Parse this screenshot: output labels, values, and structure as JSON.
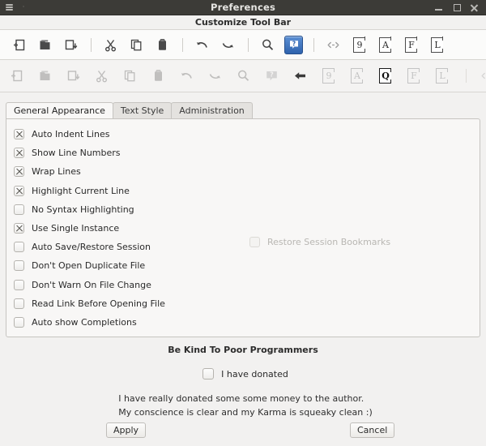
{
  "window": {
    "title": "Preferences",
    "menu_icon": "hamburger-icon",
    "controls": {
      "minimize": "minimize-icon",
      "maximize": "maximize-icon",
      "close": "close-icon"
    }
  },
  "subheader": {
    "title": "Customize Tool Bar"
  },
  "toolbar_active": {
    "items": [
      {
        "name": "new-file-icon",
        "type": "icon",
        "label": "New File"
      },
      {
        "name": "open-folder-icon",
        "type": "icon",
        "label": "Open File"
      },
      {
        "name": "save-file-icon",
        "type": "icon",
        "label": "Save File"
      },
      {
        "name": "separator",
        "type": "sep",
        "label": ""
      },
      {
        "name": "cut-icon",
        "type": "icon",
        "label": "Cut"
      },
      {
        "name": "copy-icon",
        "type": "icon",
        "label": "Copy"
      },
      {
        "name": "paste-icon",
        "type": "icon",
        "label": "Paste"
      },
      {
        "name": "separator",
        "type": "sep",
        "label": ""
      },
      {
        "name": "undo-icon",
        "type": "icon",
        "label": "Undo"
      },
      {
        "name": "redo-icon",
        "type": "icon",
        "label": "Redo"
      },
      {
        "name": "separator",
        "type": "sep",
        "label": ""
      },
      {
        "name": "search-icon",
        "type": "icon",
        "label": "Find"
      },
      {
        "name": "help-icon",
        "type": "icon",
        "label": "Help"
      },
      {
        "name": "separator",
        "type": "sep",
        "label": ""
      },
      {
        "name": "code-tags-icon",
        "type": "icon",
        "label": "Code"
      },
      {
        "name": "line-number-box-icon",
        "type": "letterbox",
        "label": "9"
      },
      {
        "name": "letter-a-box-icon",
        "type": "letterbox",
        "label": "A"
      },
      {
        "name": "letter-f-box-icon",
        "type": "letterbox",
        "label": "F"
      },
      {
        "name": "letter-l-box-icon",
        "type": "letterbox",
        "label": "L"
      }
    ]
  },
  "toolbar_available": {
    "items": [
      {
        "name": "new-file-icon",
        "type": "icon",
        "label": "New File",
        "state": "disabled"
      },
      {
        "name": "open-folder-icon",
        "type": "icon",
        "label": "Open File",
        "state": "disabled"
      },
      {
        "name": "save-file-icon",
        "type": "icon",
        "label": "Save File",
        "state": "disabled"
      },
      {
        "name": "cut-icon",
        "type": "icon",
        "label": "Cut",
        "state": "disabled"
      },
      {
        "name": "copy-icon",
        "type": "icon",
        "label": "Copy",
        "state": "disabled"
      },
      {
        "name": "paste-icon",
        "type": "icon",
        "label": "Paste",
        "state": "disabled"
      },
      {
        "name": "undo-icon",
        "type": "icon",
        "label": "Undo",
        "state": "disabled"
      },
      {
        "name": "redo-icon",
        "type": "icon",
        "label": "Redo",
        "state": "disabled"
      },
      {
        "name": "search-icon",
        "type": "icon",
        "label": "Find",
        "state": "disabled"
      },
      {
        "name": "help-icon",
        "type": "icon",
        "label": "Help",
        "state": "disabled"
      },
      {
        "name": "back-arrow-icon",
        "type": "icon",
        "label": "Back",
        "state": "enabled"
      },
      {
        "name": "line-number-box-icon",
        "type": "letterbox",
        "label": "9",
        "state": "disabled"
      },
      {
        "name": "letter-a-box-icon",
        "type": "letterbox",
        "label": "A",
        "state": "disabled"
      },
      {
        "name": "letter-q-box-icon",
        "type": "letterbox",
        "label": "Q",
        "state": "selected"
      },
      {
        "name": "letter-f-box-icon",
        "type": "letterbox",
        "label": "F",
        "state": "disabled"
      },
      {
        "name": "letter-l-box-icon",
        "type": "letterbox",
        "label": "L",
        "state": "disabled"
      },
      {
        "name": "separator",
        "type": "sep",
        "label": "",
        "state": "disabled"
      },
      {
        "name": "code-tags-icon",
        "type": "icon",
        "label": "Code",
        "state": "disabled"
      }
    ]
  },
  "tabs": [
    {
      "label": "General Appearance",
      "active": true
    },
    {
      "label": "Text Style",
      "active": false
    },
    {
      "label": "Administration",
      "active": false
    }
  ],
  "general_appearance": {
    "left_options": [
      {
        "label": "Auto Indent Lines",
        "checked": true,
        "disabled": false
      },
      {
        "label": "Show Line Numbers",
        "checked": true,
        "disabled": false
      },
      {
        "label": "Wrap Lines",
        "checked": true,
        "disabled": false
      },
      {
        "label": "Highlight Current Line",
        "checked": true,
        "disabled": false
      },
      {
        "label": "No Syntax Highlighting",
        "checked": false,
        "disabled": false
      },
      {
        "label": "Use Single Instance",
        "checked": true,
        "disabled": false
      },
      {
        "label": "Auto Save/Restore Session",
        "checked": false,
        "disabled": false
      },
      {
        "label": "Don't Open Duplicate File",
        "checked": false,
        "disabled": false
      },
      {
        "label": "Don't Warn On File Change",
        "checked": false,
        "disabled": false
      },
      {
        "label": "Read Link Before Opening File",
        "checked": false,
        "disabled": false
      },
      {
        "label": "Auto show Completions",
        "checked": false,
        "disabled": false
      }
    ],
    "right_options": [
      {
        "label": "Restore Session Bookmarks",
        "checked": false,
        "disabled": true
      }
    ]
  },
  "donate": {
    "title": "Be Kind To Poor Programmers",
    "checkbox_label": "I have donated",
    "checked": false,
    "line1": "I have really donated some some money to the author.",
    "line2": "My conscience is clear and my Karma is squeaky clean :)"
  },
  "buttons": {
    "apply": "Apply",
    "cancel": "Cancel"
  },
  "colors": {
    "titlebar_bg": "#3c3b37",
    "window_bg": "#f2f1f0",
    "toolbar_bg": "#fbfbfa",
    "panel_bg": "#f8f7f6",
    "accent_blue": "#2f63ad",
    "text": "#2e3436"
  }
}
